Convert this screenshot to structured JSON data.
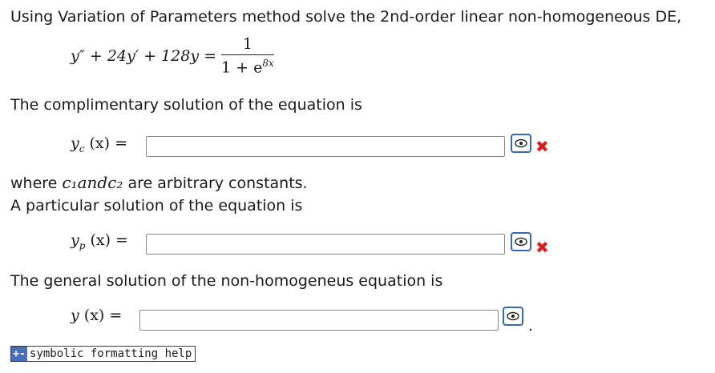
{
  "intro": "Using Variation of Parameters method solve the 2nd-order linear non-homogeneous DE,",
  "equation": {
    "lhs": "y″ + 24y′ + 128y =",
    "numerator": "1",
    "denominator_base": "1 + e",
    "denominator_exp": "8x"
  },
  "complementary": {
    "prompt": "The complimentary solution of the equation is",
    "label": "y",
    "subscript": "c",
    "arg": "(x) =",
    "value": "",
    "status": "✖"
  },
  "constants_note": {
    "prefix": "where",
    "math": "c₁andc₂",
    "suffix": "are arbitrary constants."
  },
  "particular": {
    "prompt": "A particular solution of the equation is",
    "label": "y",
    "subscript": "p",
    "arg": "(x) =",
    "value": "",
    "status": "✖"
  },
  "general": {
    "prompt": "The general solution of the non-homogeneus equation is",
    "label": "y",
    "arg": "(x) =",
    "value": "",
    "trailing": "."
  },
  "help": {
    "icon": "+-",
    "label": "symbolic formatting help"
  },
  "colors": {
    "error": "#d81e1e",
    "preview_border": "#3569b3"
  }
}
